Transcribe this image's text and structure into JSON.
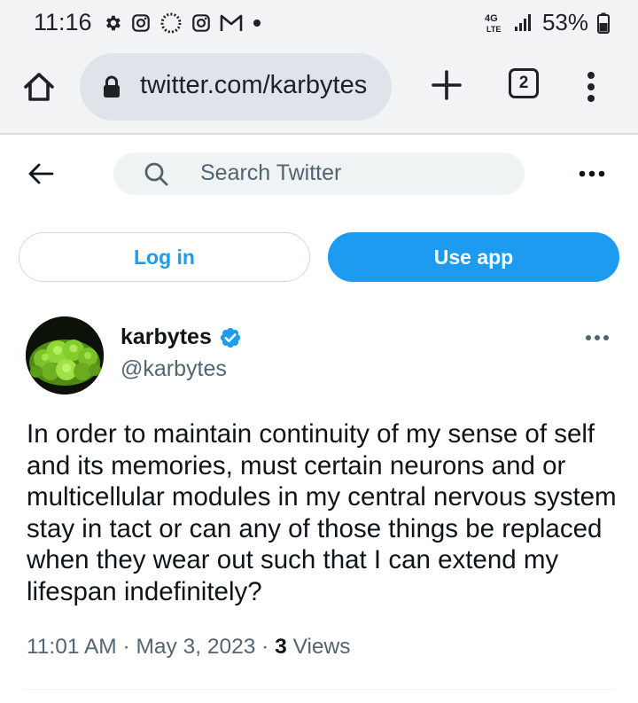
{
  "status_bar": {
    "time": "11:16",
    "network": "4G LTE",
    "battery": "53%",
    "icons": [
      "gear-icon",
      "instagram-icon",
      "spinner-icon",
      "instagram-icon",
      "gmail-icon",
      "dot-icon",
      "signal-icon",
      "battery-icon"
    ]
  },
  "browser": {
    "url": "twitter.com/karbytes",
    "tab_count": "2",
    "icons": [
      "home-icon",
      "lock-icon",
      "plus-icon",
      "more-vertical-icon"
    ]
  },
  "header": {
    "search_placeholder": "Search Twitter",
    "icons": [
      "back-arrow-icon",
      "search-icon",
      "more-horizontal-icon"
    ]
  },
  "actions": {
    "login_label": "Log in",
    "use_app_label": "Use app"
  },
  "tweet": {
    "display_name": "karbytes",
    "handle": "@karbytes",
    "verified": true,
    "text": "In order to maintain continuity of my sense of self and its memories, must certain neurons and or multicellular modules in my central nervous system stay in tact or can any of those things be replaced when they wear out such that I can extend my lifespan indefinitely?",
    "time": "11:01 AM",
    "date": "May 3, 2023",
    "separator": "·",
    "views_count": "3",
    "views_label": "Views"
  },
  "colors": {
    "accent": "#1d9bf0",
    "secondary_text": "#536471",
    "primary_text": "#0f1419",
    "browser_chrome": "#f1f3f4"
  }
}
